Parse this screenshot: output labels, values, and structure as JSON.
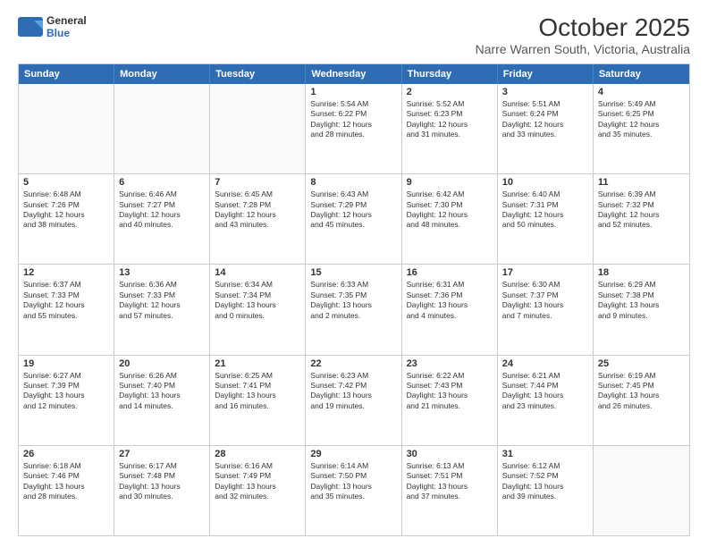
{
  "header": {
    "logo_line1": "General",
    "logo_line2": "Blue",
    "title": "October 2025",
    "subtitle": "Narre Warren South, Victoria, Australia"
  },
  "days": [
    "Sunday",
    "Monday",
    "Tuesday",
    "Wednesday",
    "Thursday",
    "Friday",
    "Saturday"
  ],
  "weeks": [
    [
      {
        "day": "",
        "text": "",
        "empty": true
      },
      {
        "day": "",
        "text": "",
        "empty": true
      },
      {
        "day": "",
        "text": "",
        "empty": true
      },
      {
        "day": "1",
        "text": "Sunrise: 5:54 AM\nSunset: 6:22 PM\nDaylight: 12 hours\nand 28 minutes.",
        "empty": false
      },
      {
        "day": "2",
        "text": "Sunrise: 5:52 AM\nSunset: 6:23 PM\nDaylight: 12 hours\nand 31 minutes.",
        "empty": false
      },
      {
        "day": "3",
        "text": "Sunrise: 5:51 AM\nSunset: 6:24 PM\nDaylight: 12 hours\nand 33 minutes.",
        "empty": false
      },
      {
        "day": "4",
        "text": "Sunrise: 5:49 AM\nSunset: 6:25 PM\nDaylight: 12 hours\nand 35 minutes.",
        "empty": false
      }
    ],
    [
      {
        "day": "5",
        "text": "Sunrise: 6:48 AM\nSunset: 7:26 PM\nDaylight: 12 hours\nand 38 minutes.",
        "empty": false
      },
      {
        "day": "6",
        "text": "Sunrise: 6:46 AM\nSunset: 7:27 PM\nDaylight: 12 hours\nand 40 minutes.",
        "empty": false
      },
      {
        "day": "7",
        "text": "Sunrise: 6:45 AM\nSunset: 7:28 PM\nDaylight: 12 hours\nand 43 minutes.",
        "empty": false
      },
      {
        "day": "8",
        "text": "Sunrise: 6:43 AM\nSunset: 7:29 PM\nDaylight: 12 hours\nand 45 minutes.",
        "empty": false
      },
      {
        "day": "9",
        "text": "Sunrise: 6:42 AM\nSunset: 7:30 PM\nDaylight: 12 hours\nand 48 minutes.",
        "empty": false
      },
      {
        "day": "10",
        "text": "Sunrise: 6:40 AM\nSunset: 7:31 PM\nDaylight: 12 hours\nand 50 minutes.",
        "empty": false
      },
      {
        "day": "11",
        "text": "Sunrise: 6:39 AM\nSunset: 7:32 PM\nDaylight: 12 hours\nand 52 minutes.",
        "empty": false
      }
    ],
    [
      {
        "day": "12",
        "text": "Sunrise: 6:37 AM\nSunset: 7:33 PM\nDaylight: 12 hours\nand 55 minutes.",
        "empty": false
      },
      {
        "day": "13",
        "text": "Sunrise: 6:36 AM\nSunset: 7:33 PM\nDaylight: 12 hours\nand 57 minutes.",
        "empty": false
      },
      {
        "day": "14",
        "text": "Sunrise: 6:34 AM\nSunset: 7:34 PM\nDaylight: 13 hours\nand 0 minutes.",
        "empty": false
      },
      {
        "day": "15",
        "text": "Sunrise: 6:33 AM\nSunset: 7:35 PM\nDaylight: 13 hours\nand 2 minutes.",
        "empty": false
      },
      {
        "day": "16",
        "text": "Sunrise: 6:31 AM\nSunset: 7:36 PM\nDaylight: 13 hours\nand 4 minutes.",
        "empty": false
      },
      {
        "day": "17",
        "text": "Sunrise: 6:30 AM\nSunset: 7:37 PM\nDaylight: 13 hours\nand 7 minutes.",
        "empty": false
      },
      {
        "day": "18",
        "text": "Sunrise: 6:29 AM\nSunset: 7:38 PM\nDaylight: 13 hours\nand 9 minutes.",
        "empty": false
      }
    ],
    [
      {
        "day": "19",
        "text": "Sunrise: 6:27 AM\nSunset: 7:39 PM\nDaylight: 13 hours\nand 12 minutes.",
        "empty": false
      },
      {
        "day": "20",
        "text": "Sunrise: 6:26 AM\nSunset: 7:40 PM\nDaylight: 13 hours\nand 14 minutes.",
        "empty": false
      },
      {
        "day": "21",
        "text": "Sunrise: 6:25 AM\nSunset: 7:41 PM\nDaylight: 13 hours\nand 16 minutes.",
        "empty": false
      },
      {
        "day": "22",
        "text": "Sunrise: 6:23 AM\nSunset: 7:42 PM\nDaylight: 13 hours\nand 19 minutes.",
        "empty": false
      },
      {
        "day": "23",
        "text": "Sunrise: 6:22 AM\nSunset: 7:43 PM\nDaylight: 13 hours\nand 21 minutes.",
        "empty": false
      },
      {
        "day": "24",
        "text": "Sunrise: 6:21 AM\nSunset: 7:44 PM\nDaylight: 13 hours\nand 23 minutes.",
        "empty": false
      },
      {
        "day": "25",
        "text": "Sunrise: 6:19 AM\nSunset: 7:45 PM\nDaylight: 13 hours\nand 26 minutes.",
        "empty": false
      }
    ],
    [
      {
        "day": "26",
        "text": "Sunrise: 6:18 AM\nSunset: 7:46 PM\nDaylight: 13 hours\nand 28 minutes.",
        "empty": false
      },
      {
        "day": "27",
        "text": "Sunrise: 6:17 AM\nSunset: 7:48 PM\nDaylight: 13 hours\nand 30 minutes.",
        "empty": false
      },
      {
        "day": "28",
        "text": "Sunrise: 6:16 AM\nSunset: 7:49 PM\nDaylight: 13 hours\nand 32 minutes.",
        "empty": false
      },
      {
        "day": "29",
        "text": "Sunrise: 6:14 AM\nSunset: 7:50 PM\nDaylight: 13 hours\nand 35 minutes.",
        "empty": false
      },
      {
        "day": "30",
        "text": "Sunrise: 6:13 AM\nSunset: 7:51 PM\nDaylight: 13 hours\nand 37 minutes.",
        "empty": false
      },
      {
        "day": "31",
        "text": "Sunrise: 6:12 AM\nSunset: 7:52 PM\nDaylight: 13 hours\nand 39 minutes.",
        "empty": false
      },
      {
        "day": "",
        "text": "",
        "empty": true
      }
    ]
  ]
}
